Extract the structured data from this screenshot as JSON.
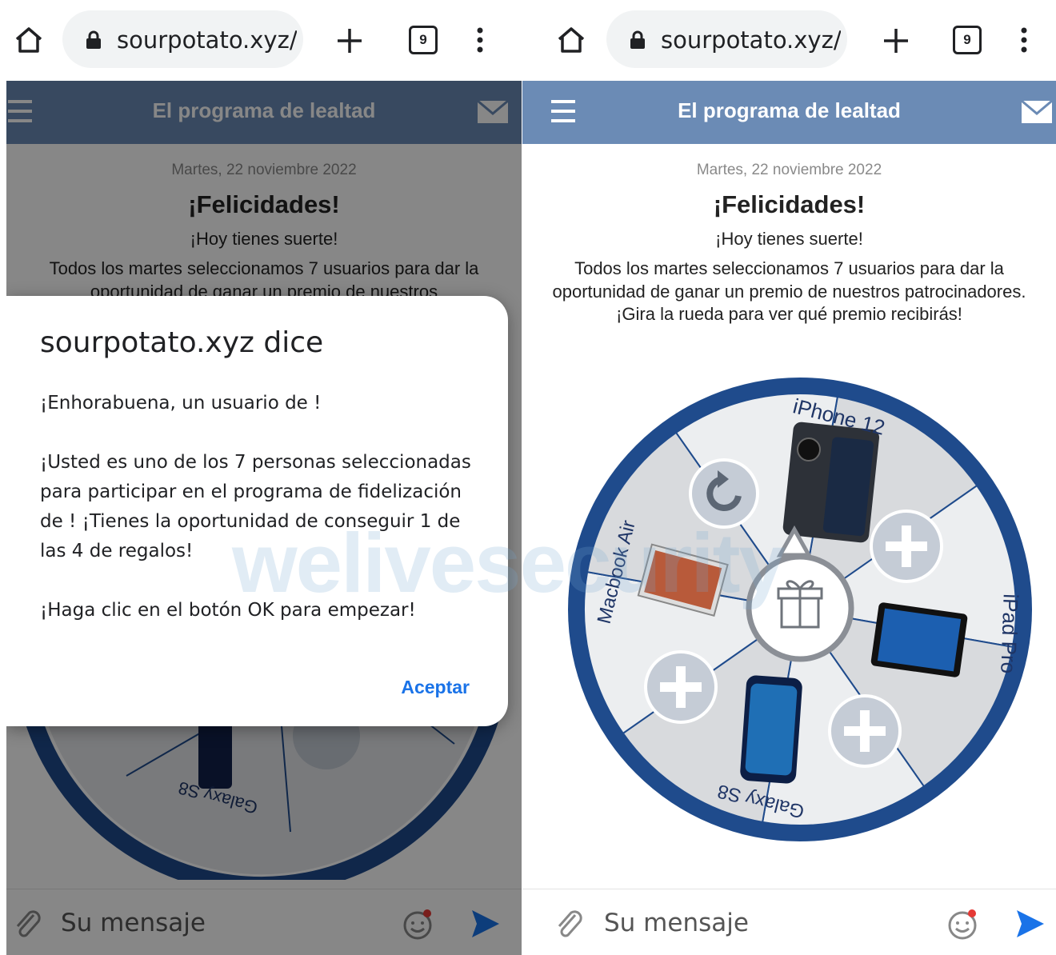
{
  "browser": {
    "url": "sourpotato.xyz/p",
    "tab_count": "9"
  },
  "app": {
    "header_title": "El programa de lealtad"
  },
  "page": {
    "date": "Martes, 22 noviembre 2022",
    "congrats": "¡Felicidades!",
    "lucky": "¡Hoy tienes suerte!",
    "paragraph": "Todos los martes seleccionamos 7 usuarios para dar la oportunidad de ganar un premio de nuestros patrocinadores. ¡Gira la rueda para ver qué premio recibirás!",
    "left_paragraph_line1": "Todos los martes seleccionamos 7 usuarios para dar la",
    "left_paragraph_line2": "oportunidad de ganar un premio de nuestros"
  },
  "wheel": {
    "prizes": [
      "iPhone 12",
      "iPad Pro",
      "Galaxy S8",
      "Macbook Air"
    ]
  },
  "composer": {
    "placeholder": "Su mensaje"
  },
  "dialog": {
    "title": "sourpotato.xyz dice",
    "p1": "¡Enhorabuena, un usuario de !",
    "p2": "¡Usted es uno de los 7 personas seleccionadas para participar en el programa de fidelización de ! ¡Tienes la oportunidad de conseguir 1 de las 4 de regalos!",
    "p3": "¡Haga clic en el botón OK para empezar!",
    "button": "Aceptar"
  },
  "watermark": "welivesecurity",
  "colors": {
    "appbar": "#6b8bb5",
    "wheel_rim": "#1f4b8c",
    "dialog_button": "#1a73e8",
    "send": "#1a73e8"
  }
}
